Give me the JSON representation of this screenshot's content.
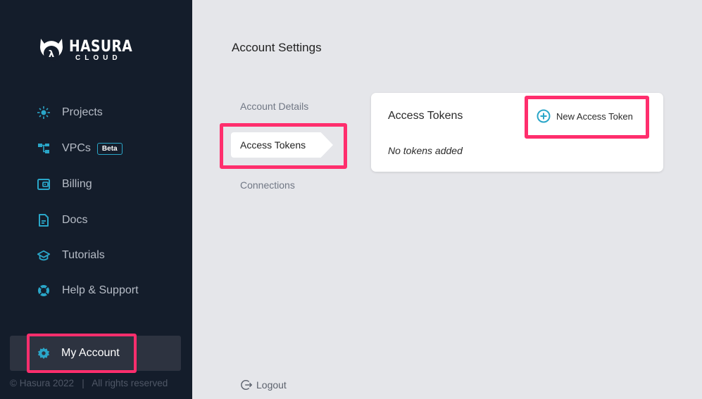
{
  "brand": {
    "name": "HASURA",
    "sub": "CLOUD",
    "accent_color": "#2aa6c8",
    "highlight_color": "#ff2e6d"
  },
  "sidebar": {
    "items": [
      {
        "label": "Projects",
        "icon": "projects-icon"
      },
      {
        "label": "VPCs",
        "icon": "vpc-icon",
        "badge": "Beta"
      },
      {
        "label": "Billing",
        "icon": "wallet-icon"
      },
      {
        "label": "Docs",
        "icon": "document-icon"
      },
      {
        "label": "Tutorials",
        "icon": "graduation-cap-icon"
      },
      {
        "label": "Help & Support",
        "icon": "lifebuoy-icon"
      }
    ],
    "my_account": {
      "label": "My Account",
      "icon": "gear-icon"
    },
    "footer": "© Hasura 2022   |   All rights reserved"
  },
  "main": {
    "title": "Account Settings",
    "subnav": [
      {
        "label": "Account Details"
      },
      {
        "label": "Access Tokens",
        "active": true
      },
      {
        "label": "Connections"
      }
    ],
    "card": {
      "title": "Access Tokens",
      "new_button": "New Access Token",
      "empty_text": "No tokens added"
    },
    "logout_label": "Logout"
  }
}
